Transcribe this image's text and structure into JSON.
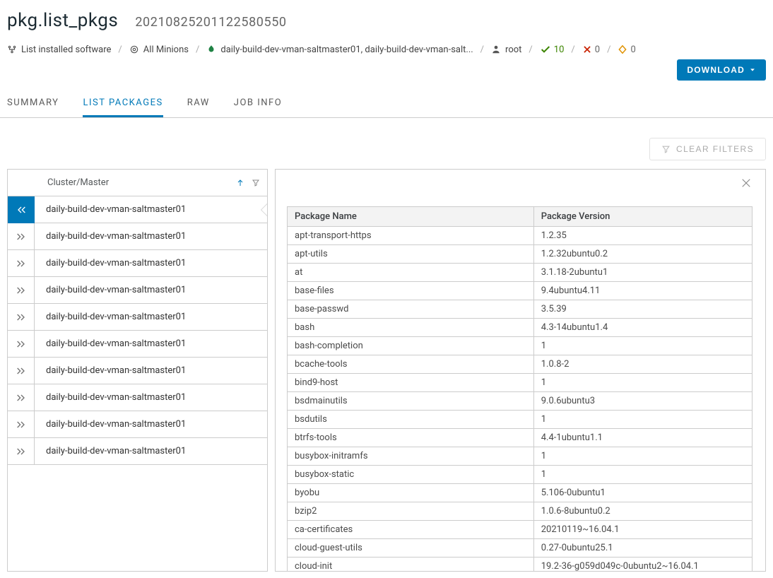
{
  "header": {
    "title": "pkg.list_pkgs",
    "subtitle": "20210825201122580550"
  },
  "breadcrumb": {
    "items": [
      {
        "label": "List installed software"
      },
      {
        "label": "All Minions"
      },
      {
        "label": "daily-build-dev-vman-saltmaster01, daily-build-dev-vman-salt..."
      },
      {
        "label": "root"
      }
    ],
    "status": {
      "success_count": "10",
      "fail_count": "0",
      "other_count": "0"
    }
  },
  "download_label": "DOWNLOAD",
  "tabs": [
    {
      "label": "SUMMARY"
    },
    {
      "label": "LIST PACKAGES"
    },
    {
      "label": "RAW"
    },
    {
      "label": "JOB INFO"
    }
  ],
  "clear_filters_label": "CLEAR FILTERS",
  "left_panel": {
    "header": "Cluster/Master",
    "rows": [
      {
        "label": "daily-build-dev-vman-saltmaster01"
      },
      {
        "label": "daily-build-dev-vman-saltmaster01"
      },
      {
        "label": "daily-build-dev-vman-saltmaster01"
      },
      {
        "label": "daily-build-dev-vman-saltmaster01"
      },
      {
        "label": "daily-build-dev-vman-saltmaster01"
      },
      {
        "label": "daily-build-dev-vman-saltmaster01"
      },
      {
        "label": "daily-build-dev-vman-saltmaster01"
      },
      {
        "label": "daily-build-dev-vman-saltmaster01"
      },
      {
        "label": "daily-build-dev-vman-saltmaster01"
      },
      {
        "label": "daily-build-dev-vman-saltmaster01"
      }
    ]
  },
  "packages": {
    "col_name": "Package Name",
    "col_version": "Package Version",
    "rows": [
      {
        "name": "apt-transport-https",
        "version": "1.2.35"
      },
      {
        "name": "apt-utils",
        "version": "1.2.32ubuntu0.2"
      },
      {
        "name": "at",
        "version": "3.1.18-2ubuntu1"
      },
      {
        "name": "base-files",
        "version": "9.4ubuntu4.11"
      },
      {
        "name": "base-passwd",
        "version": "3.5.39"
      },
      {
        "name": "bash",
        "version": "4.3-14ubuntu1.4"
      },
      {
        "name": "bash-completion",
        "version": "1"
      },
      {
        "name": "bcache-tools",
        "version": "1.0.8-2"
      },
      {
        "name": "bind9-host",
        "version": "1"
      },
      {
        "name": "bsdmainutils",
        "version": "9.0.6ubuntu3"
      },
      {
        "name": "bsdutils",
        "version": "1"
      },
      {
        "name": "btrfs-tools",
        "version": "4.4-1ubuntu1.1"
      },
      {
        "name": "busybox-initramfs",
        "version": "1"
      },
      {
        "name": "busybox-static",
        "version": "1"
      },
      {
        "name": "byobu",
        "version": "5.106-0ubuntu1"
      },
      {
        "name": "bzip2",
        "version": "1.0.6-8ubuntu0.2"
      },
      {
        "name": "ca-certificates",
        "version": "20210119~16.04.1"
      },
      {
        "name": "cloud-guest-utils",
        "version": "0.27-0ubuntu25.1"
      },
      {
        "name": "cloud-init",
        "version": "19.2-36-g059d049c-0ubuntu2~16.04.1"
      }
    ]
  }
}
